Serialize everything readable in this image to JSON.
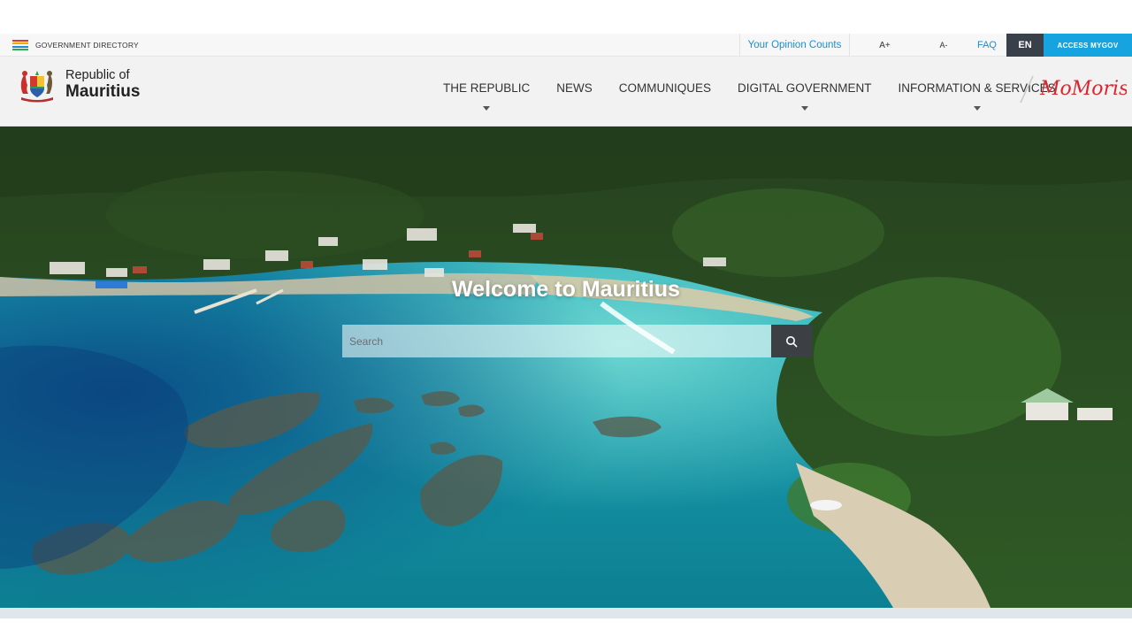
{
  "utility_bar": {
    "gov_directory_label": "GOVERNMENT DIRECTORY",
    "hamburger_colors": [
      "#e03b3b",
      "#f2a900",
      "#1a8fd0",
      "#2bab57"
    ],
    "opinion_label": "Your Opinion Counts",
    "font_increase_label": "A+",
    "font_decrease_label": "A-",
    "faq_label": "FAQ",
    "language_label": "EN",
    "access_label": "ACCESS MYGOV",
    "accent_color": "#16a4e0"
  },
  "brand": {
    "small_text": "Republic of",
    "big_text": "Mauritius"
  },
  "nav": {
    "items": [
      {
        "label": "THE REPUBLIC",
        "has_dropdown": true
      },
      {
        "label": "NEWS",
        "has_dropdown": false
      },
      {
        "label": "COMMUNIQUES",
        "has_dropdown": false
      },
      {
        "label": "DIGITAL GOVERNMENT",
        "has_dropdown": true
      },
      {
        "label": "INFORMATION & SERVICES",
        "has_dropdown": true
      }
    ],
    "partner_logo_text": "MoMoris",
    "partner_logo_color": "#d8262f"
  },
  "hero": {
    "title": "Welcome to Mauritius",
    "search_placeholder": "Search",
    "search_icon": "search-icon"
  }
}
